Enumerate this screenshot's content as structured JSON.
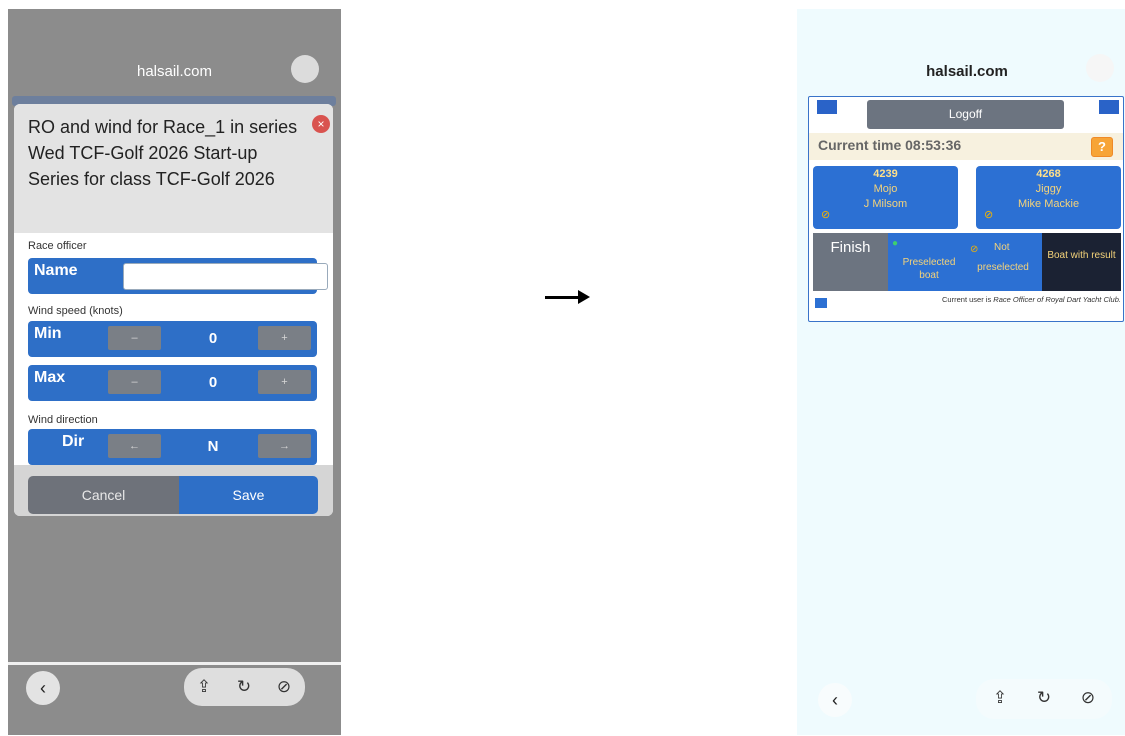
{
  "left_phone": {
    "url": "halsail.com",
    "url_icon": "reader-icon",
    "dialog": {
      "title": "RO and wind for Race_1 in series Wed TCF-Golf 2026 Start-up Series for class TCF-Golf 2026",
      "close_icon": "×",
      "race_officer_label": "Race officer",
      "name_label": "Name",
      "name_value": "",
      "wind_speed_label": "Wind speed (knots)",
      "min_label": "Min",
      "min_value": "0",
      "max_label": "Max",
      "max_value": "0",
      "minus": "–",
      "plus": "+",
      "wind_direction_label": "Wind direction",
      "dir_label": "Dir",
      "dir_value": "N",
      "left_arrow": "←",
      "right_arrow": "→",
      "cancel": "Cancel",
      "save": "Save"
    },
    "toolbar": {
      "back": "‹",
      "share": "⇪",
      "reload": "↻",
      "compass": "⊘"
    }
  },
  "right_phone": {
    "url": "halsail.com",
    "logoff": "Logoff",
    "current_time": "Current time 08:53:36",
    "help": "?",
    "boats": [
      {
        "number": "4239",
        "name": "Mojo",
        "skipper": "J Milsom"
      },
      {
        "number": "4268",
        "name": "Jiggy",
        "skipper": "Mike Mackie"
      }
    ],
    "legend": {
      "finish": "Finish",
      "preselected": "Preselected boat",
      "not_preselected_1": "Not",
      "not_preselected_2": "preselected",
      "with_result": "Boat with result"
    },
    "user_text_prefix": "Current user is ",
    "user_text_role": "Race Officer of Royal Dart Yacht Club.",
    "toolbar": {
      "back": "‹",
      "share": "⇪",
      "reload": "↻",
      "compass": "⊘"
    }
  }
}
